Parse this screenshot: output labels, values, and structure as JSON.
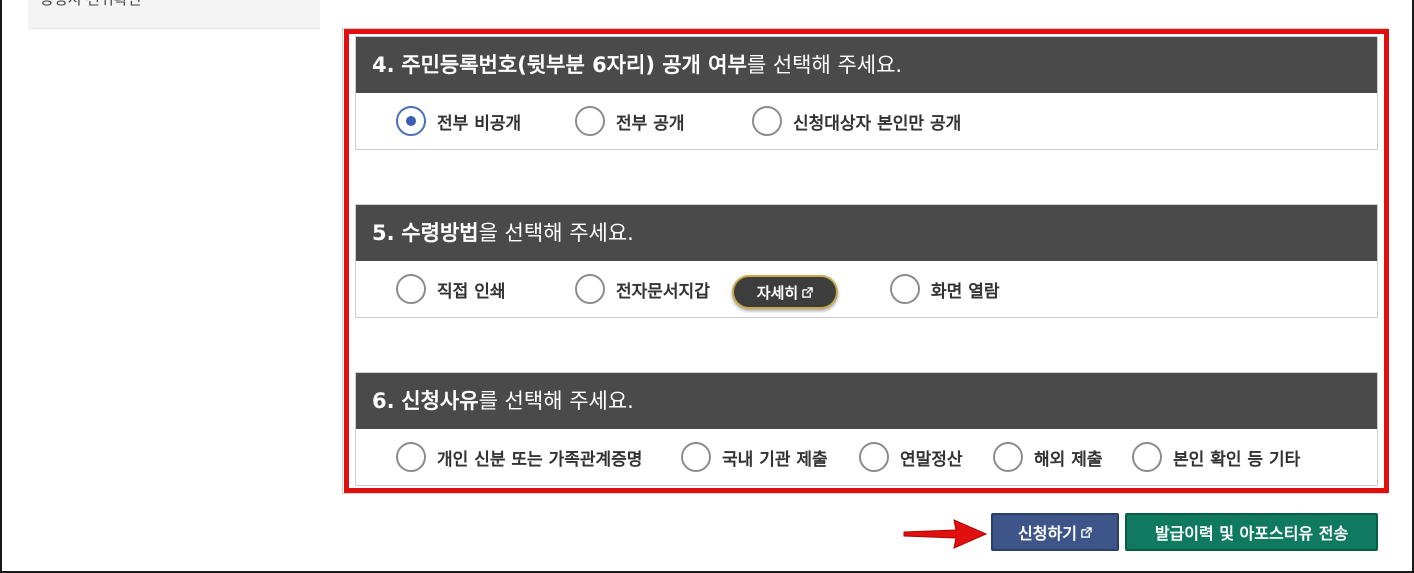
{
  "sidebar": {
    "item_label": "증명서 진위확인"
  },
  "sections": [
    {
      "number": "4.",
      "title_bold": "주민등록번호(뒷부분 6자리) 공개 여부",
      "title_rest": "를 선택해 주세요.",
      "options": [
        {
          "label": "전부 비공개",
          "checked": true
        },
        {
          "label": "전부 공개",
          "checked": false
        },
        {
          "label": "신청대상자 본인만 공개",
          "checked": false
        }
      ]
    },
    {
      "number": "5.",
      "title_bold": "수령방법",
      "title_rest": "을 선택해 주세요.",
      "options": [
        {
          "label": "직접 인쇄",
          "checked": false
        },
        {
          "label": "전자문서지갑",
          "checked": false
        },
        {
          "label": "화면 열람",
          "checked": false
        }
      ],
      "detail_button": "자세히"
    },
    {
      "number": "6.",
      "title_bold": "신청사유",
      "title_rest": "를 선택해 주세요.",
      "options": [
        {
          "label": "개인 신분 또는 가족관계증명",
          "checked": false
        },
        {
          "label": "국내 기관 제출",
          "checked": false
        },
        {
          "label": "연말정산",
          "checked": false
        },
        {
          "label": "해외 제출",
          "checked": false
        },
        {
          "label": "본인 확인 등 기타",
          "checked": false
        }
      ]
    }
  ],
  "buttons": {
    "apply": "신청하기",
    "history": "발급이력 및 아포스티유 전송"
  },
  "colors": {
    "highlight": "#e01010",
    "section_header": "#4a4a4a",
    "apply_button": "#3e5589",
    "history_button": "#0f7a60",
    "radio_checked": "#3a5fb0"
  },
  "icons": {
    "external_link": "external-link-icon",
    "arrow": "red-arrow-icon"
  }
}
